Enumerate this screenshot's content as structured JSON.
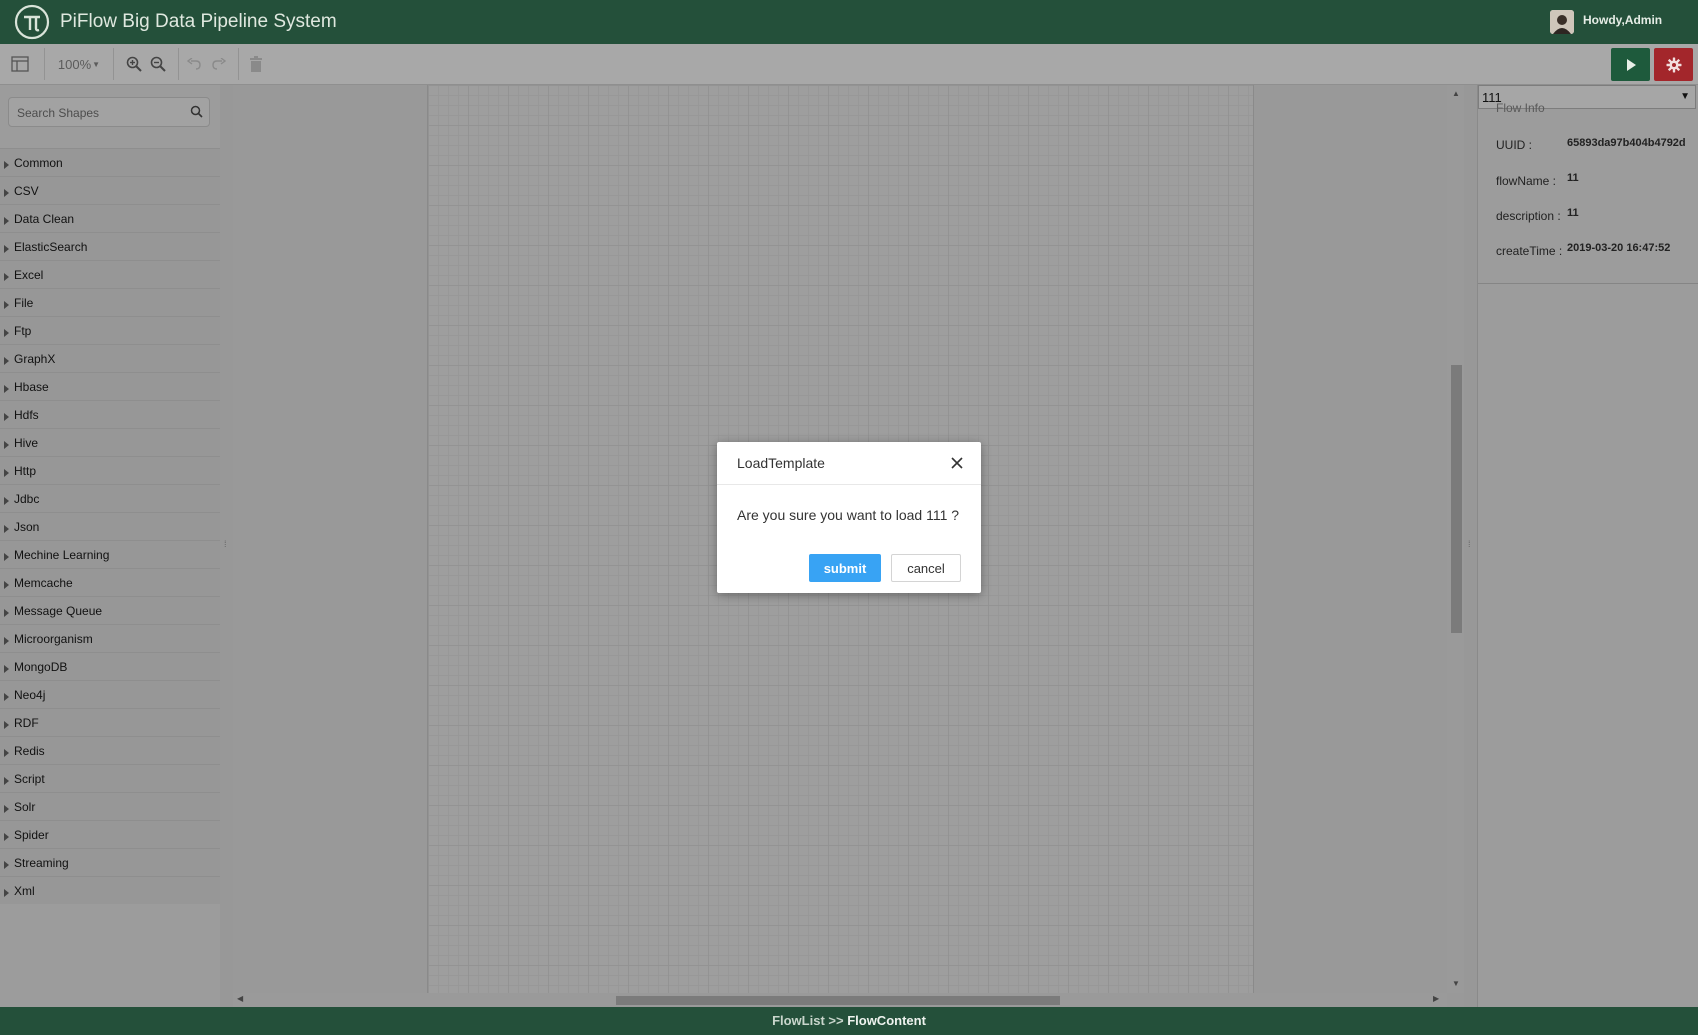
{
  "header": {
    "title": "PiFlow Big Data Pipeline System",
    "logo_icon": "piflow-logo-icon",
    "user_greeting": "Howdy,Admin",
    "background": "#24503a"
  },
  "toolbar": {
    "zoom_level": "100%",
    "panel_toggle_icon": "layout-panel-icon",
    "zoom_in_icon": "zoom-in-icon",
    "zoom_out_icon": "zoom-out-icon",
    "undo_icon": "undo-icon",
    "redo_icon": "redo-icon",
    "delete_icon": "trash-icon",
    "run_icon": "play-icon",
    "settings_icon": "gear-icon",
    "run_color": "#1e5a3c",
    "settings_color": "#a3262b"
  },
  "sidebar": {
    "search_placeholder": "Search Shapes",
    "categories": [
      "Common",
      "CSV",
      "Data Clean",
      "ElasticSearch",
      "Excel",
      "File",
      "Ftp",
      "GraphX",
      "Hbase",
      "Hdfs",
      "Hive",
      "Http",
      "Jdbc",
      "Json",
      "Mechine Learning",
      "Memcache",
      "Message Queue",
      "Microorganism",
      "MongoDB",
      "Neo4j",
      "RDF",
      "Redis",
      "Script",
      "Solr",
      "Spider",
      "Streaming",
      "Xml"
    ]
  },
  "right_panel": {
    "selected_template": "111",
    "info_title": "Flow Info",
    "fields": [
      {
        "key": "UUID :",
        "value": "65893da97b404b4792d"
      },
      {
        "key": "flowName :",
        "value": "11"
      },
      {
        "key": "description :",
        "value": "11"
      },
      {
        "key": "createTime :",
        "value": "2019-03-20 16:47:52"
      }
    ]
  },
  "modal": {
    "title": "LoadTemplate",
    "message": "Are you sure you want to load 111 ?",
    "submit_label": "submit",
    "cancel_label": "cancel",
    "submit_color": "#38a3f4"
  },
  "footer": {
    "breadcrumb_parent": "FlowList >>",
    "breadcrumb_current": "FlowContent"
  }
}
